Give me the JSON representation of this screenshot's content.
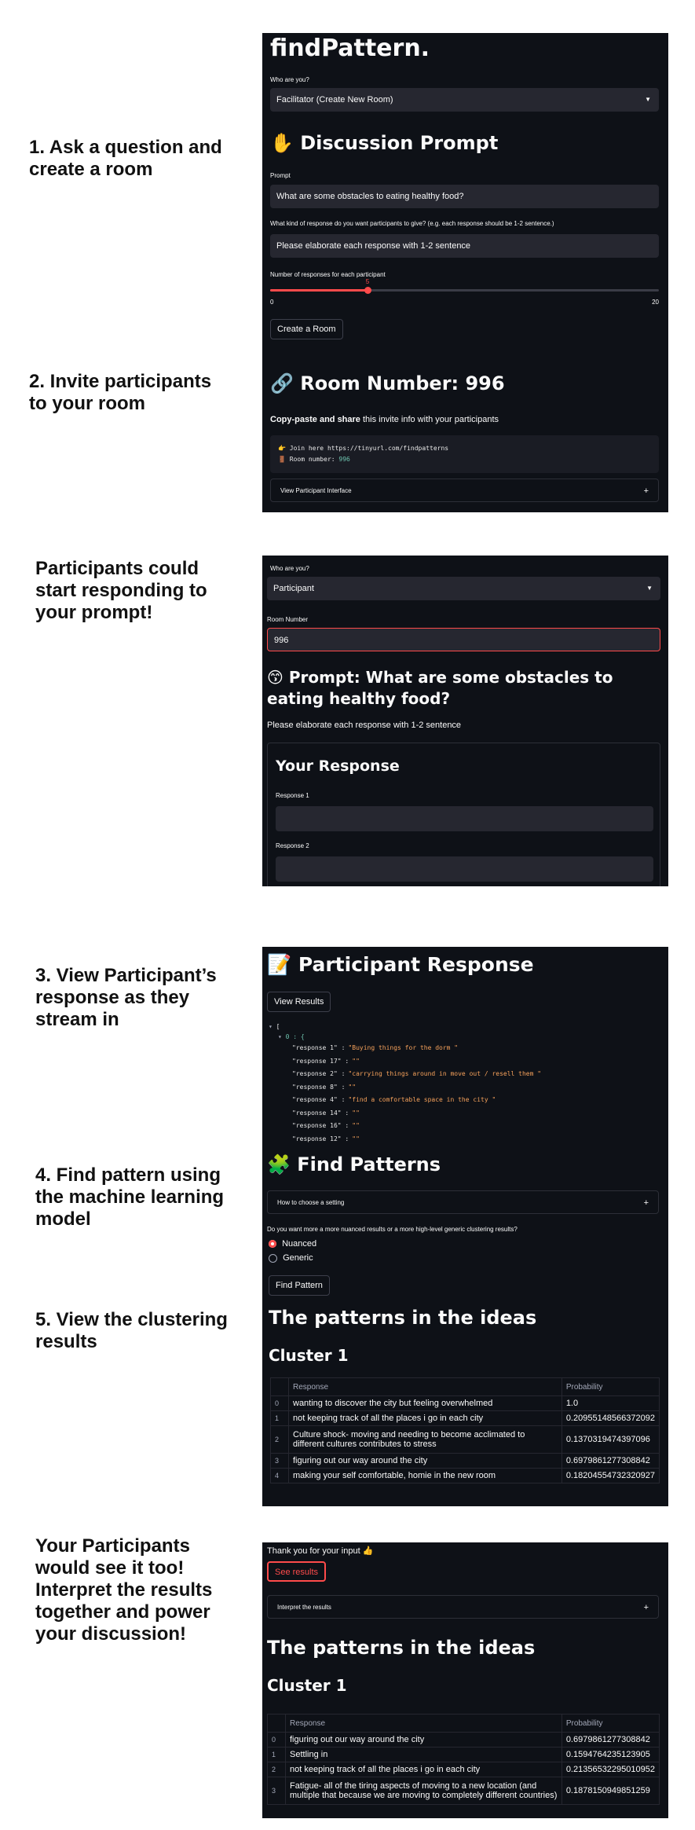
{
  "captions": {
    "step1": "1. Ask a question and create a room",
    "step2": "2. Invite participants to your room",
    "step2b": "Participants could start responding to your prompt!",
    "step3": "3. View Participant’s response as they stream in",
    "step4": "4. Find pattern using the machine learning model",
    "step5": "5. View the clustering results",
    "step6": "Your Participants would see it too! Interpret the results together and power your discussion!"
  },
  "panel1": {
    "app_title": "findPattern.",
    "who_label": "Who are you?",
    "who_value": "Facilitator (Create New Room)",
    "section_title": "✋ Discussion Prompt",
    "prompt_label": "Prompt",
    "prompt_value": "What are some obstacles to eating healthy food?",
    "kind_label": "What kind of response do you want participants to give? (e.g. each response should be 1-2 sentence.)",
    "kind_value": "Please elaborate each response with 1-2 sentence",
    "num_label": "Number of responses for each participant",
    "slider_value": "5",
    "slider_min": "0",
    "slider_max": "20",
    "slider_fraction": 0.25,
    "create_button": "Create a Room"
  },
  "panel2": {
    "room_title": "🔗 Room Number: 996",
    "share_bold": "Copy-paste and share",
    "share_rest": " this invite info with your participants",
    "code_line1_prefix": "👉 Join here ",
    "code_line1_url": "https://tinyurl.com/findpatterns",
    "code_line2_prefix": "🚪 Room number: ",
    "code_line2_num": "996",
    "expander": "View Participant Interface",
    "expander_icon": "+"
  },
  "panel3": {
    "who_label": "Who are you?",
    "who_value": "Participant",
    "room_label": "Room Number",
    "room_value": "996",
    "prompt_title": "😙 Prompt: What are some obstacles to eating healthy food?",
    "instruction": "Please elaborate each response with 1-2 sentence",
    "your_response": "Your Response",
    "response1_label": "Response 1",
    "response2_label": "Response 2"
  },
  "panel4": {
    "title": "📝 Participant Response",
    "view_button": "View Results",
    "json_open": "[",
    "json_obj": "0 : {",
    "json_entries": [
      {
        "key": "\"response 1\" :",
        "value": "\"Buying things for the dorm \""
      },
      {
        "key": "\"response 17\" :",
        "value": "\"\""
      },
      {
        "key": "\"response 2\" :",
        "value": "\"carrying things around in move out / resell them \""
      },
      {
        "key": "\"response 8\" :",
        "value": "\"\""
      },
      {
        "key": "\"response 4\" :",
        "value": "\"find a comfortable space in the city \""
      },
      {
        "key": "\"response 14\" :",
        "value": "\"\""
      },
      {
        "key": "\"response 16\" :",
        "value": "\"\""
      },
      {
        "key": "\"response 12\" :",
        "value": "\"\""
      }
    ],
    "find_title": "🧩 Find Patterns",
    "how_expander": "How to choose a setting",
    "question": "Do you want more a more nuanced results or a more high-level generic clustering results?",
    "radio1": "Nuanced",
    "radio2": "Generic",
    "find_button": "Find Pattern",
    "patterns_title": "The patterns in the ideas",
    "cluster_title": "Cluster 1",
    "col_response": "Response",
    "col_prob": "Probability",
    "rows": [
      {
        "i": "0",
        "r": "wanting to discover the city but feeling overwhelmed",
        "p": "1.0"
      },
      {
        "i": "1",
        "r": "not keeping track of all the places i go in each city",
        "p": "0.20955148566372092"
      },
      {
        "i": "2",
        "r": "Culture shock- moving and needing to become acclimated to different cultures contributes to stress",
        "p": "0.1370319474397096"
      },
      {
        "i": "3",
        "r": "figuring out our way around the city",
        "p": "0.6979861277308842"
      },
      {
        "i": "4",
        "r": "making your self comfortable, homie in the new room",
        "p": "0.18204554732320927"
      }
    ]
  },
  "panel5": {
    "thanks": "Thank you for your input 👍",
    "see_button": "See results",
    "interpret_expander": "Interpret the results",
    "patterns_title": "The patterns in the ideas",
    "cluster_title": "Cluster 1",
    "col_response": "Response",
    "col_prob": "Probability",
    "rows": [
      {
        "i": "0",
        "r": "figuring out our way around the city",
        "p": "0.6979861277308842"
      },
      {
        "i": "1",
        "r": "Settling in",
        "p": "0.1594764235123905"
      },
      {
        "i": "2",
        "r": "not keeping track of all the places i go in each city",
        "p": "0.21356532295010952"
      },
      {
        "i": "3",
        "r": "Fatigue- all of the tiring aspects of moving to a new location (and multiple that because we are moving to completely different countries)",
        "p": "0.1878150949851259"
      }
    ]
  },
  "colors": {
    "accent": "#ff4b4b",
    "background": "#0e1117",
    "widget": "#262730",
    "json_string": "#f5a15b"
  }
}
